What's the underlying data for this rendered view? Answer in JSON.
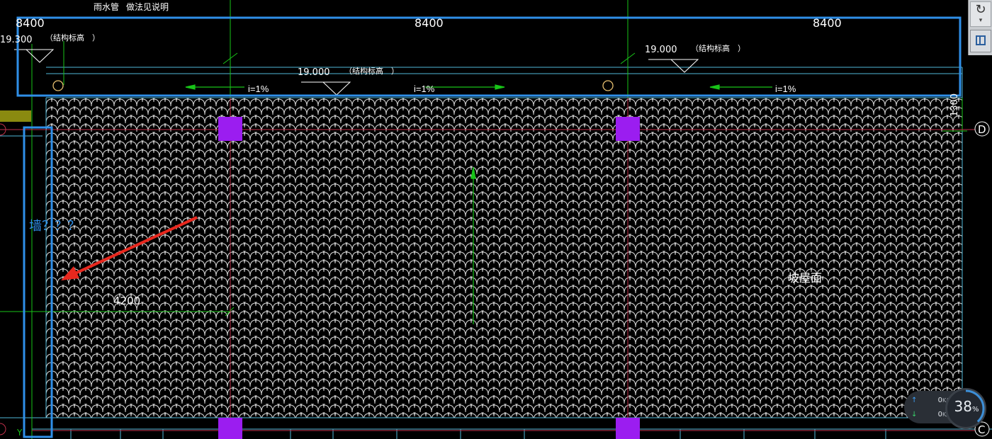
{
  "drawing": {
    "top_labels": [
      "雨水管",
      "做法见说明"
    ],
    "dimensions": [
      "8400",
      "8400",
      "8400",
      "4200"
    ],
    "elevation_tag": "（结构标高　）",
    "elevations": [
      "19.300",
      "19.000",
      "19.000"
    ],
    "slopes": [
      "i=1%",
      "i=1%",
      "i=1%"
    ],
    "vertical_dimension": "1300",
    "axis_labels": [
      "D",
      "C",
      "Y"
    ],
    "roof_label": "坡屋面",
    "annotation": "墙？？？",
    "colors": {
      "background": "#000000",
      "highlight_box": "#2f8fe8",
      "red_arrow": "#e8281e",
      "columns": "#9b1df0",
      "grid_axis": "#c0304a",
      "green": "#18c418",
      "cyan_line": "#4fb8d8",
      "roof_tiles": "#d8d8d8"
    }
  },
  "toolbar": {
    "redo_icon": "redo-icon",
    "layout_icon": "layout-grid-icon"
  },
  "net_monitor": {
    "upload": "0",
    "download": "0",
    "unit": "K/s",
    "cpu_percent": "38",
    "percent_sign": "%"
  }
}
